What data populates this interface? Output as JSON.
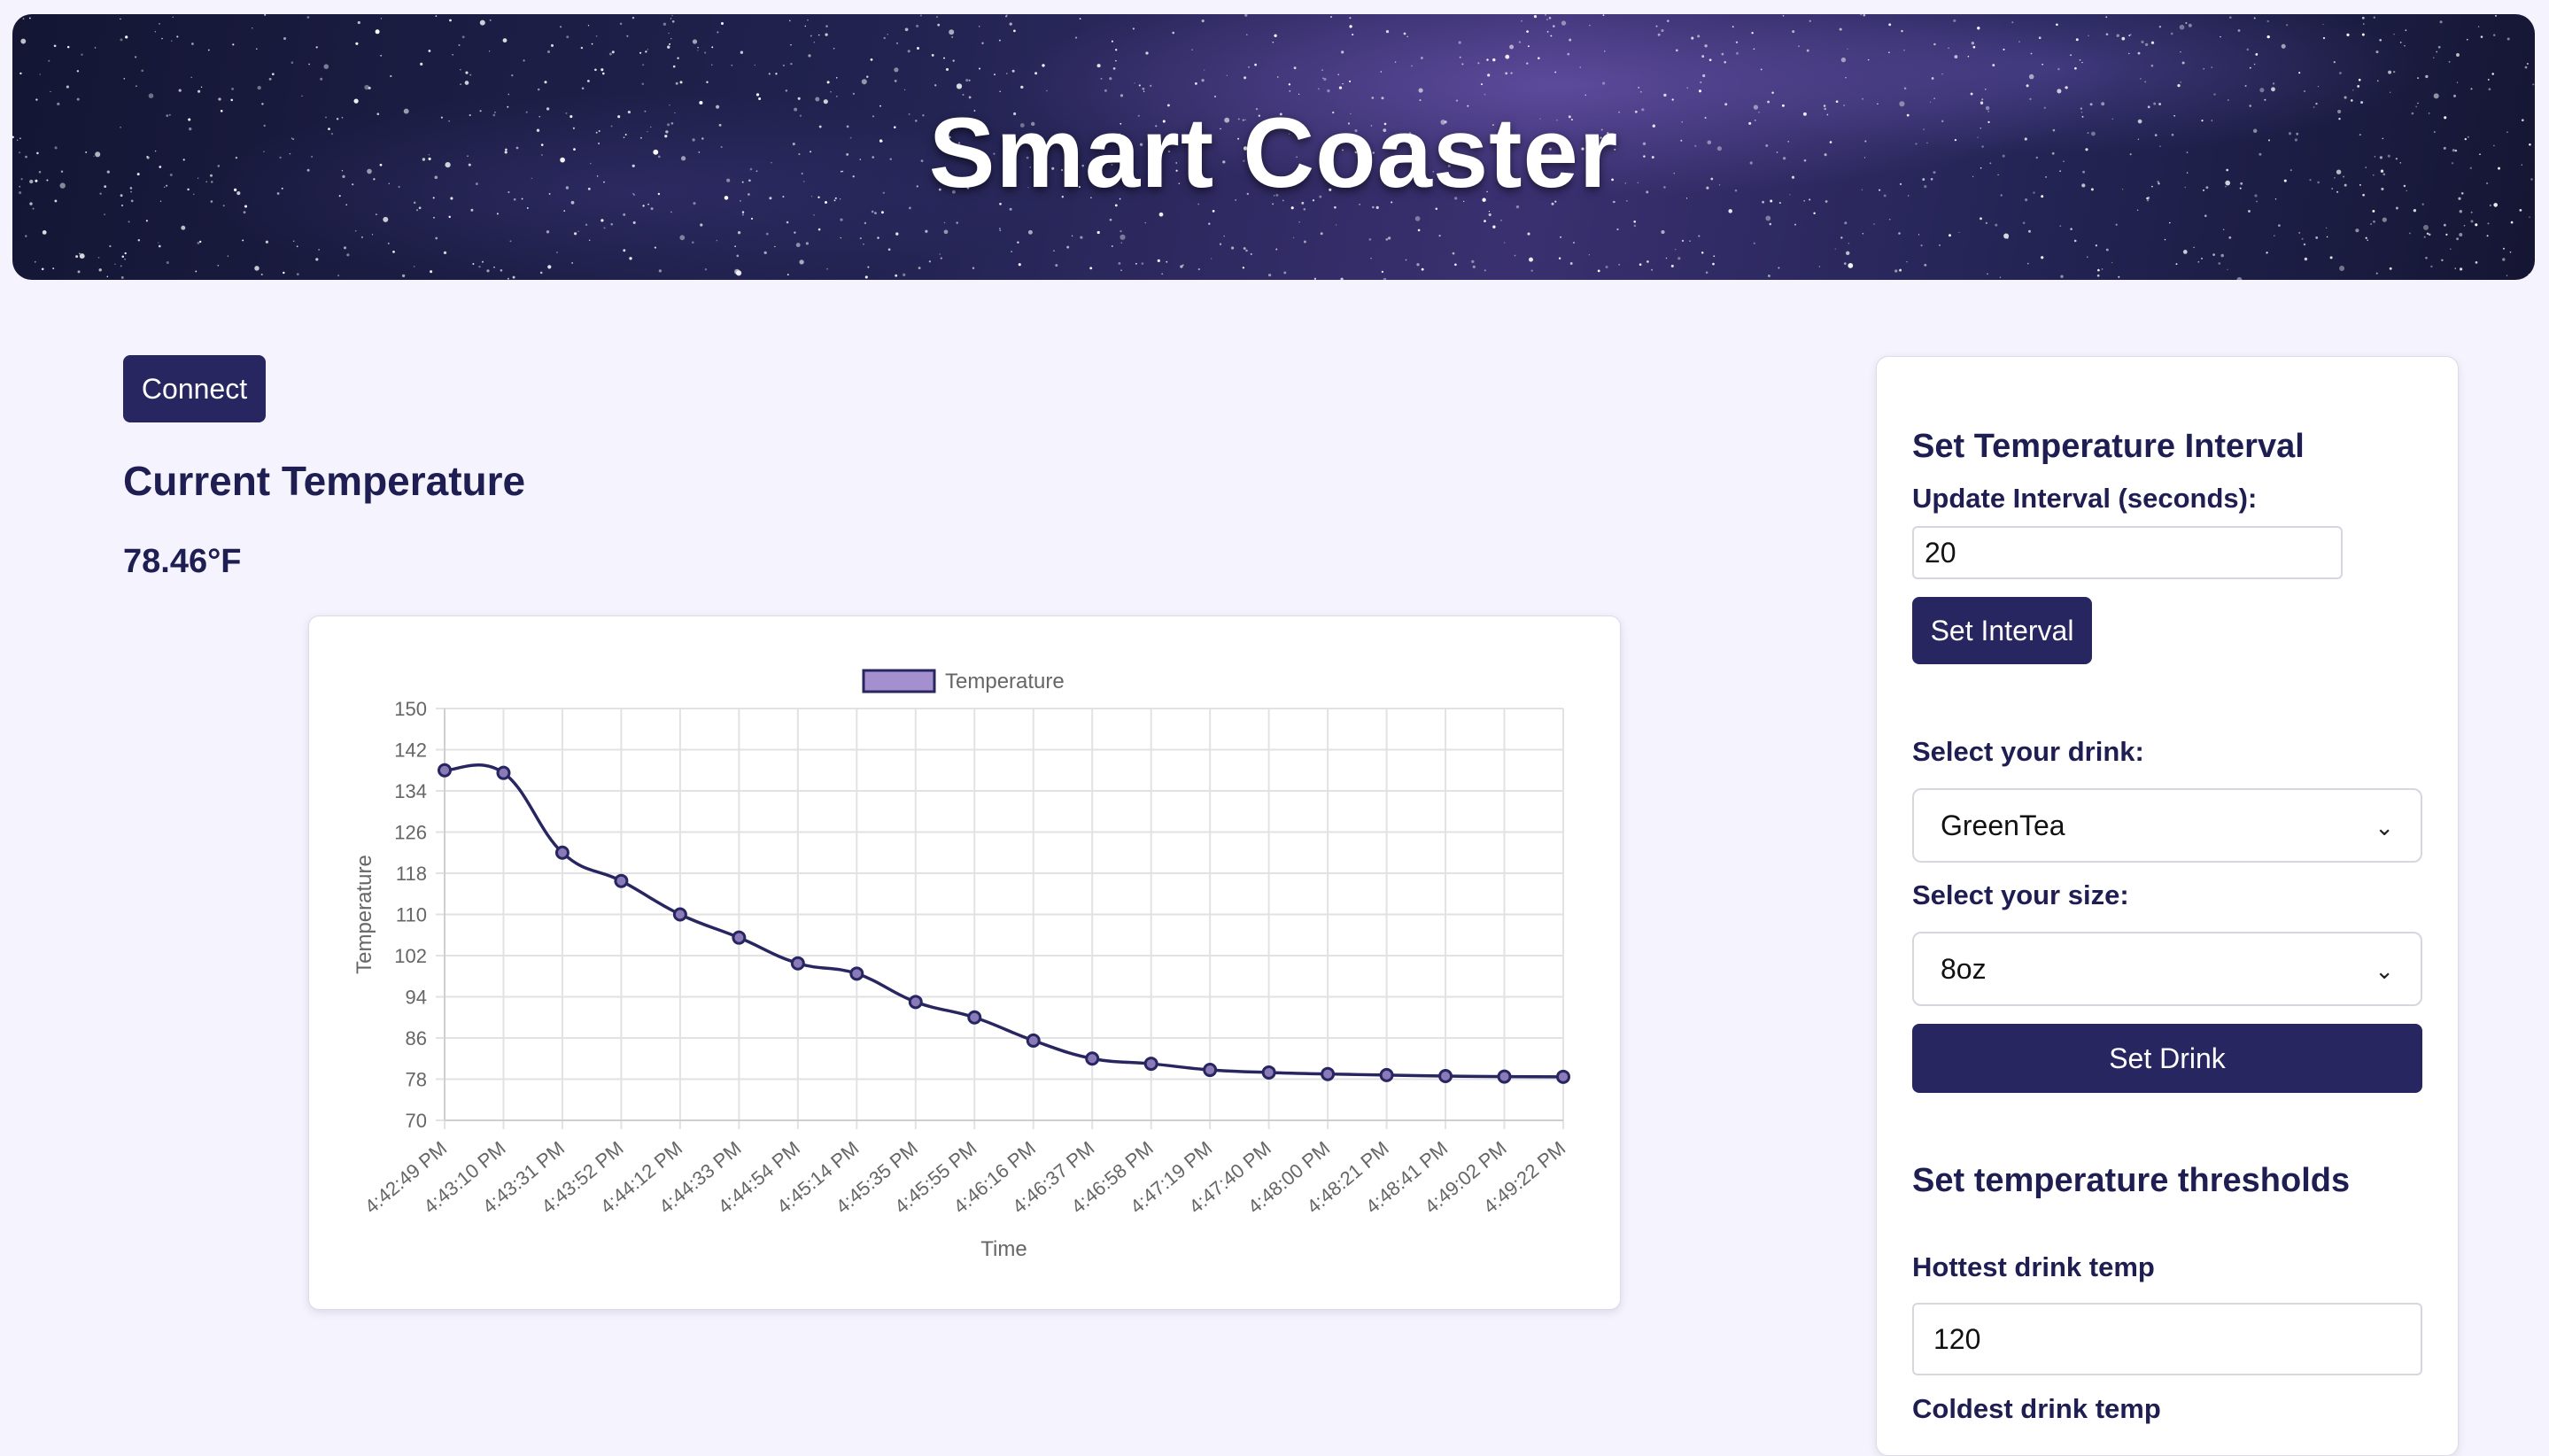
{
  "header": {
    "title": "Smart Coaster"
  },
  "connect_label": "Connect",
  "current_temperature": {
    "heading": "Current Temperature",
    "value": "78.46°F"
  },
  "chart_data": {
    "type": "line",
    "legend_label": "Temperature",
    "xlabel": "Time",
    "ylabel": "Temperature",
    "ylim": [
      70,
      150
    ],
    "yticks": [
      150,
      142,
      134,
      126,
      118,
      110,
      102,
      94,
      86,
      78,
      70
    ],
    "categories": [
      "4:42:49 PM",
      "4:43:10 PM",
      "4:43:31 PM",
      "4:43:52 PM",
      "4:44:12 PM",
      "4:44:33 PM",
      "4:44:54 PM",
      "4:45:14 PM",
      "4:45:35 PM",
      "4:45:55 PM",
      "4:46:16 PM",
      "4:46:37 PM",
      "4:46:58 PM",
      "4:47:19 PM",
      "4:47:40 PM",
      "4:48:00 PM",
      "4:48:21 PM",
      "4:48:41 PM",
      "4:49:02 PM",
      "4:49:22 PM"
    ],
    "series": [
      {
        "name": "Temperature",
        "values": [
          138,
          137.5,
          122,
          116.5,
          110,
          105.5,
          100.5,
          98.5,
          93,
          90,
          85.5,
          82,
          81,
          79.8,
          79.3,
          79,
          78.8,
          78.6,
          78.5,
          78.46
        ]
      }
    ],
    "grid": true,
    "legend_position": "top",
    "colors": {
      "line": "#272660",
      "legend_fill": "#a48fcf"
    }
  },
  "interval": {
    "heading": "Set Temperature Interval",
    "label": "Update Interval (seconds):",
    "value": "20",
    "button": "Set Interval"
  },
  "drink": {
    "label": "Select your drink:",
    "selected": "GreenTea",
    "size_label": "Select your size:",
    "size_selected": "8oz",
    "button": "Set Drink"
  },
  "thresholds": {
    "heading": "Set temperature thresholds",
    "hottest_label": "Hottest drink temp",
    "hottest_value": "120",
    "coldest_label": "Coldest drink temp"
  },
  "colors": {
    "page_bg": "#f5f3fd",
    "button_bg": "#272660",
    "heading": "#1f1e52"
  }
}
